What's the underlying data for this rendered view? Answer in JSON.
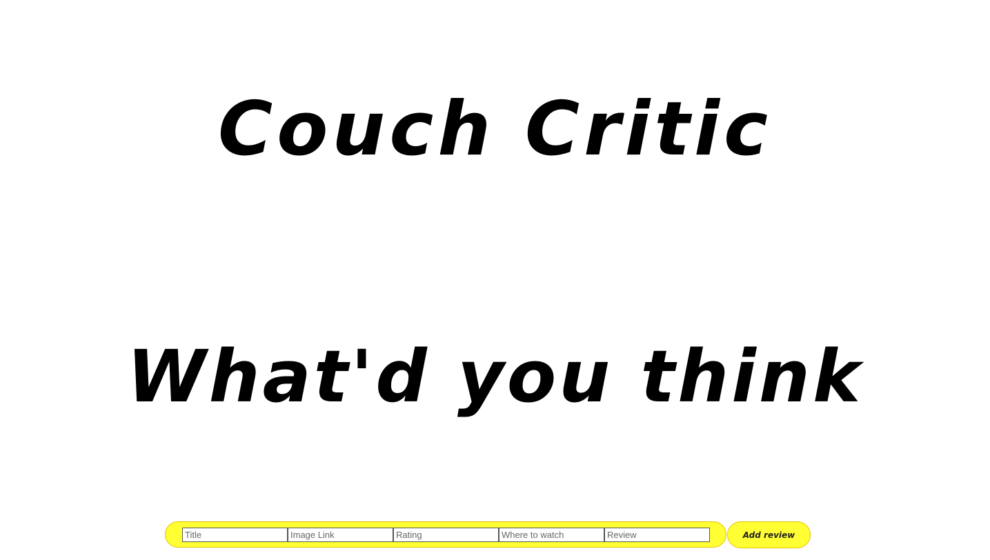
{
  "header": {
    "title": "Couch Critic"
  },
  "main": {
    "heading": "What'd you think"
  },
  "review_form": {
    "title_placeholder": "Title",
    "image_link_placeholder": "Image Link",
    "rating_placeholder": "Rating",
    "where_to_watch_placeholder": "Where to watch",
    "review_placeholder": "Review",
    "submit_label": "Add review"
  },
  "colors": {
    "accent": "#ffff33",
    "accent_border": "#e6c200",
    "text": "#000000",
    "background": "#ffffff"
  }
}
